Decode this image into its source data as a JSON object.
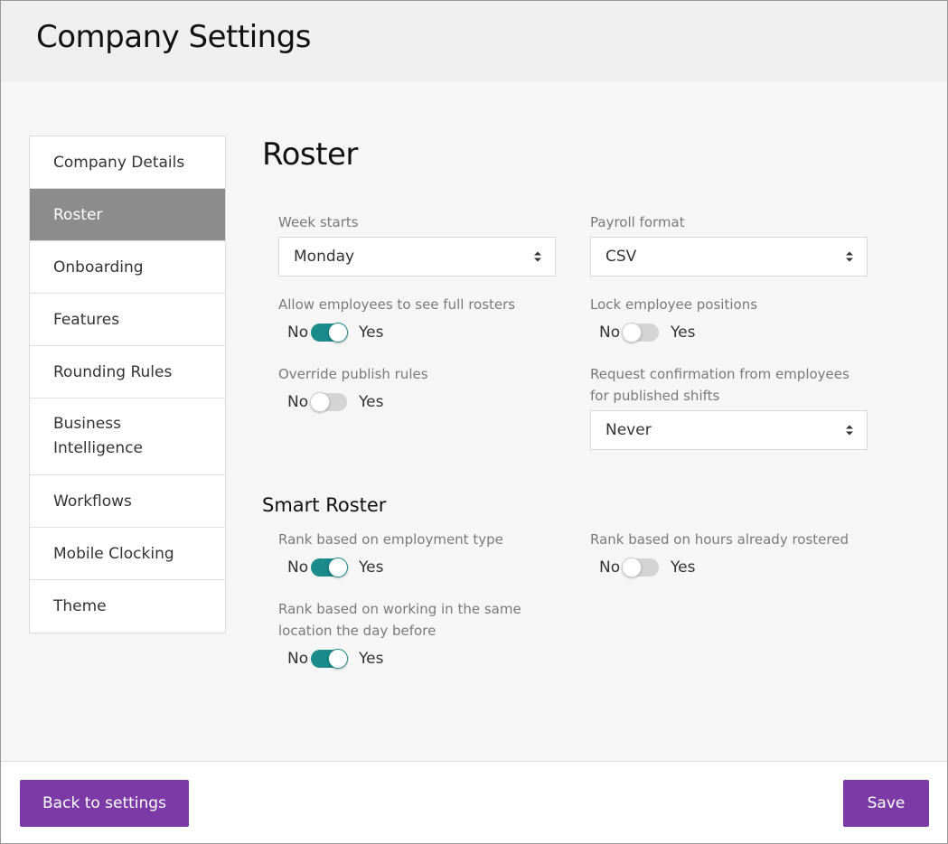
{
  "header": {
    "title": "Company Settings"
  },
  "sidebar": {
    "items": [
      {
        "label": "Company Details"
      },
      {
        "label": "Roster"
      },
      {
        "label": "Onboarding"
      },
      {
        "label": "Features"
      },
      {
        "label": "Rounding Rules"
      },
      {
        "label": "Business Intelligence"
      },
      {
        "label": "Workflows"
      },
      {
        "label": "Mobile Clocking"
      },
      {
        "label": "Theme"
      }
    ],
    "active_index": 1
  },
  "roster": {
    "title": "Roster",
    "week_starts": {
      "label": "Week starts",
      "value": "Monday"
    },
    "payroll_format": {
      "label": "Payroll format",
      "value": "CSV"
    },
    "allow_full_rosters": {
      "label": "Allow employees to see full rosters",
      "no": "No",
      "yes": "Yes",
      "on": true
    },
    "lock_positions": {
      "label": "Lock employee positions",
      "no": "No",
      "yes": "Yes",
      "on": false
    },
    "override_publish": {
      "label": "Override publish rules",
      "no": "No",
      "yes": "Yes",
      "on": false
    },
    "request_confirmation": {
      "label_line1": "Request confirmation from employees",
      "label_line2": "for published shifts",
      "value": "Never"
    }
  },
  "smart_roster": {
    "title": "Smart Roster",
    "rank_employment_type": {
      "label": "Rank based on employment type",
      "no": "No",
      "yes": "Yes",
      "on": true
    },
    "rank_hours": {
      "label": "Rank based on hours already rostered",
      "no": "No",
      "yes": "Yes",
      "on": false
    },
    "rank_same_location": {
      "label_line1": "Rank based on working in the same",
      "label_line2": "location the day before",
      "no": "No",
      "yes": "Yes",
      "on": true
    }
  },
  "footer": {
    "back_label": "Back to settings",
    "save_label": "Save"
  },
  "colors": {
    "accent": "#7b3aa5",
    "toggle_on": "#1a8a8a",
    "sidebar_active": "#8c8c8c"
  }
}
